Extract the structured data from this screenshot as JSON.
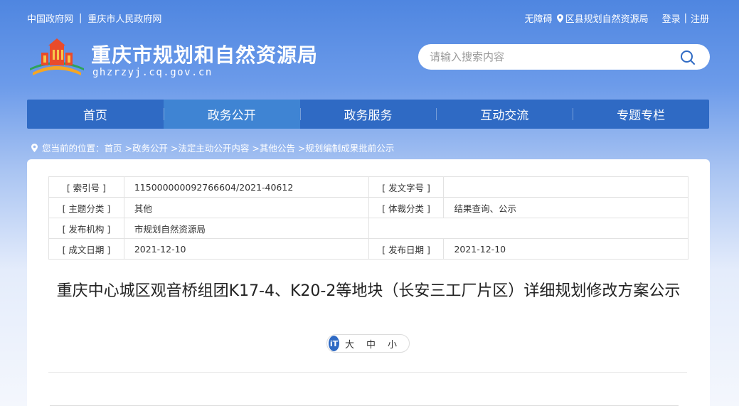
{
  "topbar": {
    "links_left": [
      "中国政府网",
      "重庆市人民政府网"
    ],
    "separator": "|",
    "accessibility": "无障碍",
    "region": "区县规划自然资源局",
    "login": "登录",
    "register_sep": "|",
    "register": "注册"
  },
  "header": {
    "title": "重庆市规划和自然资源局",
    "domain": "ghzrzyj.cq.gov.cn"
  },
  "search": {
    "placeholder": "请输入搜索内容"
  },
  "nav": {
    "items": [
      "首页",
      "政务公开",
      "政务服务",
      "互动交流",
      "专题专栏"
    ],
    "active_index": 1
  },
  "breadcrumb": {
    "text": "您当前的位置：首页 >政务公开 >法定主动公开内容 >其他公告 >规划编制成果批前公示"
  },
  "meta": {
    "index_label": "[ 索引号 ]",
    "index_value": "115000000092766604/2021-40612",
    "doc_no_label": "[ 发文字号 ]",
    "doc_no_value": "",
    "topic_label": "[ 主题分类 ]",
    "topic_value": "其他",
    "genre_label": "[ 体裁分类 ]",
    "genre_value": "结果查询、公示",
    "issuer_label": "[ 发布机构 ]",
    "issuer_value": "市规划自然资源局",
    "created_label": "[ 成文日期 ]",
    "created_value": "2021-12-10",
    "published_label": "[ 发布日期 ]",
    "published_value": "2021-12-10"
  },
  "document": {
    "title": "重庆中心城区观音桥组团K17-4、K20-2等地块（长安三工厂片区）详细规划修改方案公示"
  },
  "fontsize": {
    "icon_text": "iT",
    "large": "大",
    "medium": "中",
    "small": "小"
  },
  "colors": {
    "nav_bg": "#2f6ac4",
    "nav_active": "#3f84d3",
    "header_gradient_top": "#4f86e0"
  }
}
